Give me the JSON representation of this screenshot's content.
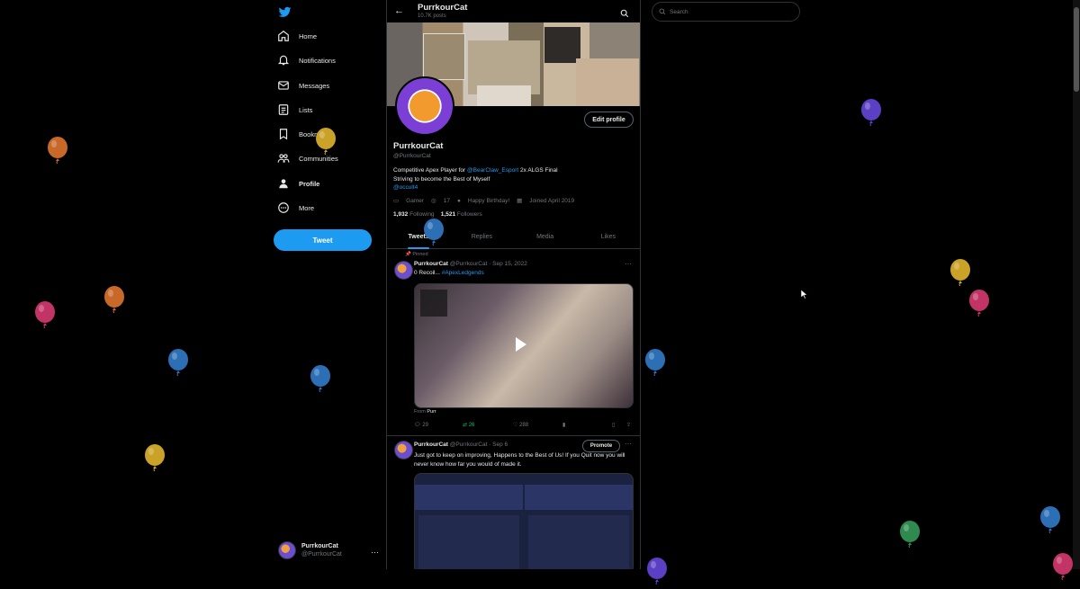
{
  "nav": {
    "items": [
      {
        "label": "Home",
        "icon": "home-icon"
      },
      {
        "label": "Notifications",
        "icon": "bell-icon"
      },
      {
        "label": "Messages",
        "icon": "envelope-icon"
      },
      {
        "label": "Lists",
        "icon": "list-icon"
      },
      {
        "label": "Bookmarks",
        "icon": "bookmark-icon"
      },
      {
        "label": "Communities",
        "icon": "people-icon"
      },
      {
        "label": "Profile",
        "icon": "person-icon"
      },
      {
        "label": "More",
        "icon": "more-circle-icon"
      }
    ],
    "tweet_label": "Tweet",
    "account_name": "PurrkourCat",
    "account_handle": "@PurrkourCat"
  },
  "header": {
    "title": "PurrkourCat",
    "subtitle": "10.7K posts"
  },
  "search": {
    "placeholder": "Search"
  },
  "profile": {
    "edit_label": "Edit profile",
    "name": "PurrkourCat",
    "handle": "@PurrkourCat",
    "bio_prefix": "Competitive Apex Player for ",
    "bio_mention": "@BearClaw_Esport",
    "bio_suffix": " 2x ALGS Final",
    "bio_line2": "Striving to become the Best of Myself",
    "bio_link": "@occult4",
    "meta_category": "Gamer",
    "meta_location": "17",
    "meta_birthday": "Happy Birthday!",
    "meta_joined": "Joined April 2019",
    "following_count": "1,932",
    "following_label": "Following",
    "followers_count": "1,521",
    "followers_label": "Followers"
  },
  "tabs": [
    "Tweets",
    "Replies",
    "Media",
    "Likes"
  ],
  "tweets": [
    {
      "pinned_label": "Pinned",
      "name": "PurrkourCat",
      "handle": "@PurrkourCat · Sep 15, 2022",
      "text": "0 Recoil... ",
      "hashtag": "#ApexLedgends",
      "from_label": "From",
      "from_name": "Purr",
      "replies": "29",
      "retweets": "26",
      "likes": "288"
    },
    {
      "name": "PurrkourCat",
      "handle": "@PurrkourCat · Sep 6",
      "promote_label": "Promote",
      "text": "Just got to keep on improving, Happens to the Best of Us! If you Quit now you will never know how far you would of made it."
    }
  ],
  "colors": {
    "accent": "#1d9bf0",
    "retweet": "#00ba7c",
    "background": "#000000"
  },
  "balloons": [
    "orange",
    "gold",
    "blue",
    "pink",
    "purple",
    "green"
  ]
}
